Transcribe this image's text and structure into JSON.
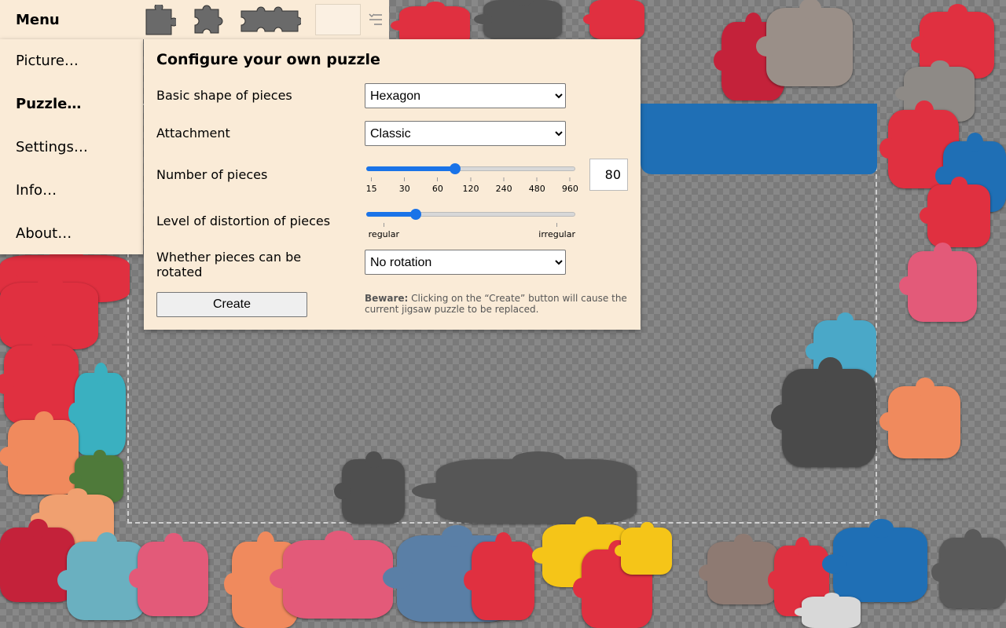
{
  "topbar": {
    "menu_label": "Menu",
    "icons": [
      "puzzle-piece-icon",
      "puzzle-piece-outline-icon",
      "puzzle-strip-icon",
      "list-icon"
    ]
  },
  "menu": {
    "items": [
      {
        "label": "Picture…"
      },
      {
        "label": "Puzzle…"
      },
      {
        "label": "Settings…"
      },
      {
        "label": "Info…"
      },
      {
        "label": "About…"
      }
    ],
    "active_index": 1
  },
  "config": {
    "title": "Configure your own puzzle",
    "shape": {
      "label": "Basic shape of pieces",
      "value": "Hexagon"
    },
    "attachment": {
      "label": "Attachment",
      "value": "Classic"
    },
    "pieces": {
      "label": "Number of pieces",
      "ticks": [
        "15",
        "30",
        "60",
        "120",
        "240",
        "480",
        "960"
      ],
      "slider_fraction": 0.425,
      "value": "80"
    },
    "distortion": {
      "label": "Level of distortion of pieces",
      "tick_min": "regular",
      "tick_max": "irregular",
      "slider_fraction": 0.235
    },
    "rotation": {
      "label": "Whether pieces can be rotated",
      "value": "No rotation"
    },
    "create_label": "Create",
    "beware_bold": "Beware:",
    "beware_text": "Clicking on the “Create” button will cause the current jigsaw puzzle to be replaced."
  },
  "colors": {
    "panel_bg": "#faebd7",
    "accent": "#1a73e8",
    "piece_red": "#e03040",
    "piece_blue": "#1f6fb5"
  }
}
